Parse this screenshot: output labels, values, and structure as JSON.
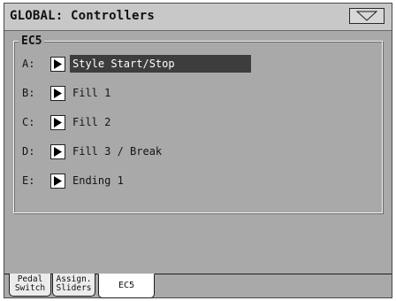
{
  "header": {
    "title": "GLOBAL: Controllers",
    "menu_icon": "triangle-down-icon"
  },
  "section": {
    "label": "EC5"
  },
  "assignments": [
    {
      "letter": "A:",
      "value": "Style Start/Stop",
      "selected": true
    },
    {
      "letter": "B:",
      "value": "Fill 1",
      "selected": false
    },
    {
      "letter": "C:",
      "value": "Fill 2",
      "selected": false
    },
    {
      "letter": "D:",
      "value": "Fill 3 / Break",
      "selected": false
    },
    {
      "letter": "E:",
      "value": "Ending 1",
      "selected": false
    }
  ],
  "tabs": [
    {
      "line1": "Pedal",
      "line2": "Switch",
      "active": false
    },
    {
      "line1": "Assign.",
      "line2": "Sliders",
      "active": false
    },
    {
      "line1": "EC5",
      "line2": "",
      "active": true
    }
  ],
  "colors": {
    "screen_bg": "#a9a9a9",
    "selection_bg": "#3d3d3d"
  }
}
